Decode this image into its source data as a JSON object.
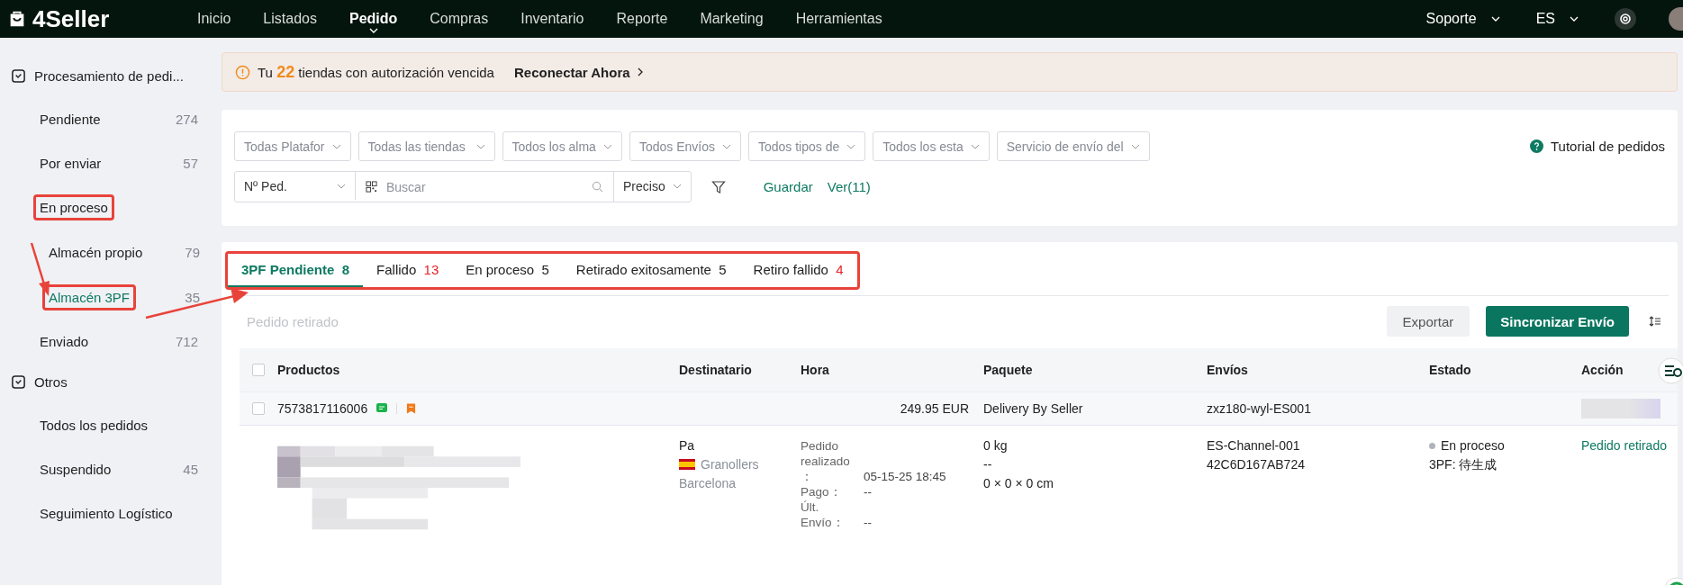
{
  "app": {
    "logo": "4Seller"
  },
  "nav": [
    {
      "label": "Inicio",
      "selected": false
    },
    {
      "label": "Listados",
      "selected": false
    },
    {
      "label": "Pedido",
      "selected": true
    },
    {
      "label": "Compras",
      "selected": false
    },
    {
      "label": "Inventario",
      "selected": false
    },
    {
      "label": "Reporte",
      "selected": false
    },
    {
      "label": "Marketing",
      "selected": false
    },
    {
      "label": "Herramientas",
      "selected": false
    }
  ],
  "header_right": {
    "support": "Soporte",
    "language": "ES"
  },
  "sidebar": {
    "sections": [
      {
        "title": "Procesamiento de pedi...",
        "items": [
          {
            "label": "Pendiente",
            "count": "274",
            "selected": false,
            "highlighted": false
          },
          {
            "label": "Por enviar",
            "count": "57",
            "selected": false,
            "highlighted": false
          },
          {
            "label": "En proceso",
            "selected": false,
            "highlighted": true,
            "children": [
              {
                "label": "Almacén propio",
                "count": "79",
                "selected": false,
                "highlighted": false
              },
              {
                "label": "Almacén 3PF",
                "count": "35",
                "selected": true,
                "highlighted": true
              }
            ]
          },
          {
            "label": "Enviado",
            "count": "712",
            "selected": false,
            "highlighted": false
          }
        ]
      },
      {
        "title": "Otros",
        "items": [
          {
            "label": "Todos los pedidos",
            "selected": false,
            "highlighted": false
          },
          {
            "label": "Suspendido",
            "count": "45",
            "selected": false,
            "highlighted": false
          },
          {
            "label": "Seguimiento Logístico",
            "selected": false,
            "highlighted": false
          }
        ]
      }
    ]
  },
  "alert": {
    "prefix": "Tu",
    "count": "22",
    "text": "tiendas con autorización vencida",
    "link": "Reconectar Ahora"
  },
  "filters": [
    {
      "placeholder": "Todas Platafor"
    },
    {
      "placeholder": "Todas las tiendas"
    },
    {
      "placeholder": "Todos los alma"
    },
    {
      "placeholder": "Todos Envíos"
    },
    {
      "placeholder": "Todos tipos de"
    },
    {
      "placeholder": "Todos los esta"
    },
    {
      "placeholder": "Servicio de envío del"
    }
  ],
  "tutorial": "Tutorial de pedidos",
  "search": {
    "field_type": "Nº Ped.",
    "placeholder": "Buscar",
    "match": "Preciso",
    "save": "Guardar",
    "views": "Ver(11)"
  },
  "status_tabs": {
    "highlighted": true,
    "tabs": [
      {
        "label": "3PF Pendiente",
        "count": "8",
        "selected": true,
        "alert": false
      },
      {
        "label": "Fallido",
        "count": "13",
        "selected": false,
        "alert": true
      },
      {
        "label": "En proceso",
        "count": "5",
        "selected": false,
        "alert": false
      },
      {
        "label": "Retirado exitosamente",
        "count": "5",
        "selected": false,
        "alert": false
      },
      {
        "label": "Retiro fallido",
        "count": "4",
        "selected": false,
        "alert": true
      }
    ]
  },
  "toolbar": {
    "bulk_action": "Pedido retirado",
    "bulk_disabled": true,
    "export": "Exportar",
    "sync": "Sincronizar Envío"
  },
  "table": {
    "all_checked": false,
    "columns": [
      "Productos",
      "Destinatario",
      "Hora",
      "Paquete",
      "Envíos",
      "Estado",
      "Acción"
    ],
    "orders": [
      {
        "checked": false,
        "order_no": "7573817116006",
        "total": "249.95 EUR",
        "channel": "Delivery By Seller",
        "shipping_id": "zxz180-wyl-ES001",
        "recipient": {
          "name": "Pa",
          "city": "Granollers",
          "province": "Barcelona"
        },
        "times": [
          {
            "label": "Pedido realizado ：",
            "value": "05-15-25 18:45"
          },
          {
            "label": "Pago：",
            "value": "--"
          },
          {
            "label": "Últ. Envío：",
            "value": "--"
          }
        ],
        "package": [
          "0 kg",
          "--",
          "0 × 0 × 0 cm"
        ],
        "shipment": [
          "ES-Channel-001",
          "42C6D167AB724"
        ],
        "status": "En proceso",
        "status_detail": "3PF: 待生成",
        "action": "Pedido retirado"
      }
    ]
  }
}
